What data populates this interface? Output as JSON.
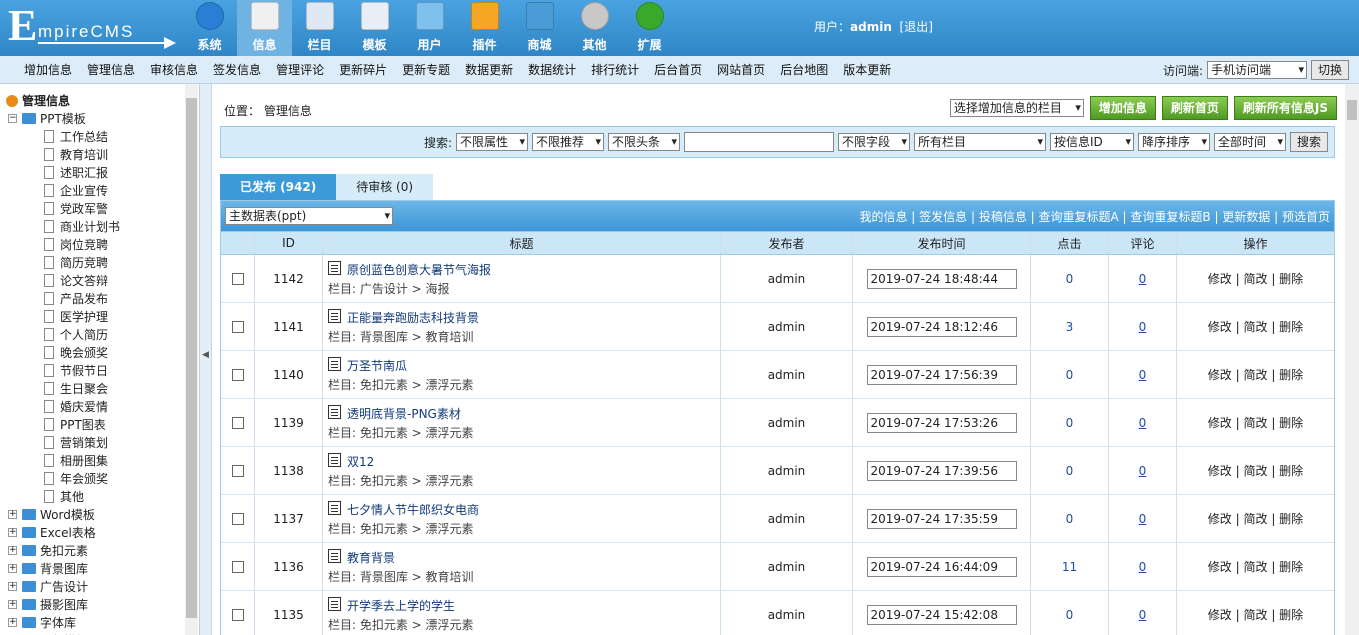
{
  "logo": {
    "big": "E",
    "small": "mpireCMS"
  },
  "topnav": [
    {
      "label": "系统",
      "icon": "globe-icon"
    },
    {
      "label": "信息",
      "icon": "notepad-icon",
      "active": true
    },
    {
      "label": "栏目",
      "icon": "folder-icon"
    },
    {
      "label": "模板",
      "icon": "window-icon"
    },
    {
      "label": "用户",
      "icon": "user-icon"
    },
    {
      "label": "插件",
      "icon": "tools-icon"
    },
    {
      "label": "商城",
      "icon": "card-icon"
    },
    {
      "label": "其他",
      "icon": "gear-icon"
    },
    {
      "label": "扩展",
      "icon": "plus-icon"
    }
  ],
  "user": {
    "prefix": "用户：",
    "name": "admin",
    "logout": "[退出]"
  },
  "subnav": [
    "增加信息",
    "管理信息",
    "审核信息",
    "签发信息",
    "管理评论",
    "更新碎片",
    "更新专题",
    "数据更新",
    "数据统计",
    "排行统计",
    "后台首页",
    "网站首页",
    "后台地图",
    "版本更新"
  ],
  "visit": {
    "label": "访问端:",
    "value": "手机访问端",
    "button": "切换"
  },
  "tree": {
    "root": "管理信息",
    "open": "PPT模板",
    "children": [
      "工作总结",
      "教育培训",
      "述职汇报",
      "企业宣传",
      "党政军警",
      "商业计划书",
      "岗位竞聘",
      "简历竞聘",
      "论文答辩",
      "产品发布",
      "医学护理",
      "个人简历",
      "晚会颁奖",
      "节假节日",
      "生日聚会",
      "婚庆爱情",
      "PPT图表",
      "营销策划",
      "相册图集",
      "年会颁奖",
      "其他"
    ],
    "folders": [
      "Word模板",
      "Excel表格",
      "免扣元素",
      "背景图库",
      "广告设计",
      "摄影图库",
      "字体库",
      "视频模板"
    ]
  },
  "location": {
    "label": "位置：",
    "value": "管理信息"
  },
  "topbuttons": {
    "select": "选择增加信息的栏目",
    "add": "增加信息",
    "refresh_home": "刷新首页",
    "refresh_all": "刷新所有信息JS"
  },
  "search": {
    "label": "搜索:",
    "attr": "不限属性",
    "rec": "不限推荐",
    "head": "不限头条",
    "field": "不限字段",
    "column": "所有栏目",
    "order_by": "按信息ID",
    "order": "降序排序",
    "time": "全部时间",
    "button": "搜索"
  },
  "tabs": {
    "published": "已发布 (942)",
    "pending": "待审核 (0)"
  },
  "table": {
    "datatable": "主数据表(ppt)",
    "links": [
      "我的信息",
      "签发信息",
      "投稿信息",
      "查询重复标题A",
      "查询重复标题B",
      "更新数据",
      "预选首页"
    ],
    "headers": {
      "id": "ID",
      "title": "标题",
      "author": "发布者",
      "time": "发布时间",
      "clicks": "点击",
      "comments": "评论",
      "ops": "操作"
    },
    "ops": {
      "edit": "修改",
      "simple": "简改",
      "delete": "删除"
    },
    "rows": [
      {
        "id": "1142",
        "title": "原创蓝色创意大暑节气海报",
        "cat": "栏目: 广告设计 > 海报",
        "author": "admin",
        "time": "2019-07-24 18:48:44",
        "clicks": "0",
        "comments": "0"
      },
      {
        "id": "1141",
        "title": "正能量奔跑励志科技背景",
        "cat": "栏目: 背景图库 > 教育培训",
        "author": "admin",
        "time": "2019-07-24 18:12:46",
        "clicks": "3",
        "comments": "0"
      },
      {
        "id": "1140",
        "title": "万圣节南瓜",
        "cat": "栏目: 免扣元素 > 漂浮元素",
        "author": "admin",
        "time": "2019-07-24 17:56:39",
        "clicks": "0",
        "comments": "0"
      },
      {
        "id": "1139",
        "title": "透明底背景-PNG素材",
        "cat": "栏目: 免扣元素 > 漂浮元素",
        "author": "admin",
        "time": "2019-07-24 17:53:26",
        "clicks": "0",
        "comments": "0"
      },
      {
        "id": "1138",
        "title": "双12",
        "cat": "栏目: 免扣元素 > 漂浮元素",
        "author": "admin",
        "time": "2019-07-24 17:39:56",
        "clicks": "0",
        "comments": "0"
      },
      {
        "id": "1137",
        "title": "七夕情人节牛郎织女电商",
        "cat": "栏目: 免扣元素 > 漂浮元素",
        "author": "admin",
        "time": "2019-07-24 17:35:59",
        "clicks": "0",
        "comments": "0"
      },
      {
        "id": "1136",
        "title": "教育背景",
        "cat": "栏目: 背景图库 > 教育培训",
        "author": "admin",
        "time": "2019-07-24 16:44:09",
        "clicks": "11",
        "comments": "0"
      },
      {
        "id": "1135",
        "title": "开学季去上学的学生",
        "cat": "栏目: 免扣元素 > 漂浮元素",
        "author": "admin",
        "time": "2019-07-24 15:42:08",
        "clicks": "0",
        "comments": "0"
      }
    ]
  }
}
